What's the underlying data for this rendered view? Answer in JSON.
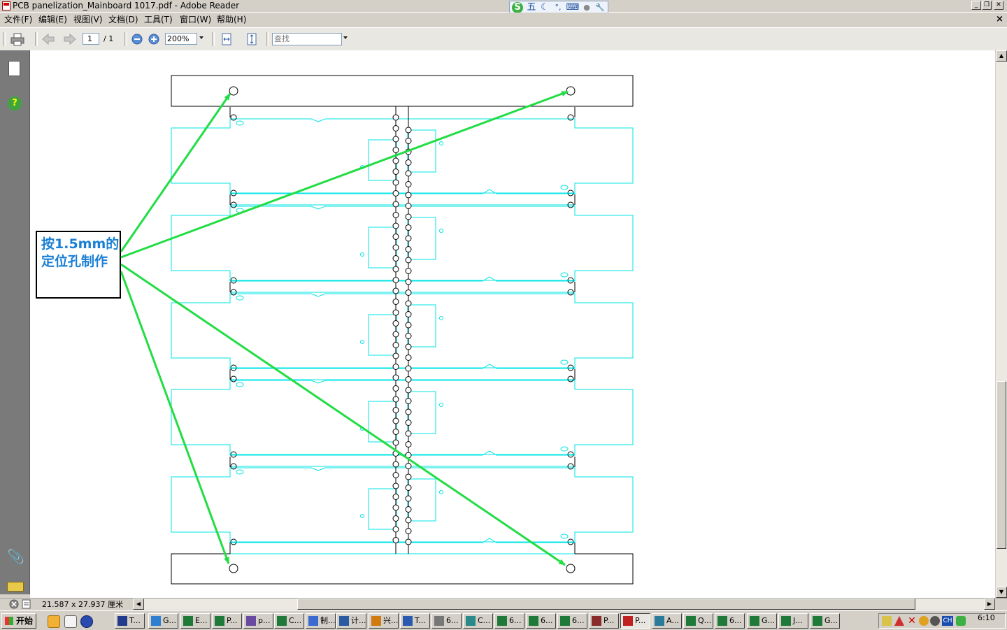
{
  "window": {
    "title": "PCB panelization_Mainboard 1017.pdf - Adobe Reader",
    "min_glyph": "_",
    "restore_glyph": "❐",
    "close_glyph": "✕"
  },
  "ime_bar": {
    "items": [
      "S",
      "五",
      "☾",
      "°,",
      "⌨",
      "●",
      "🔧"
    ]
  },
  "menu": {
    "items": [
      "文件(F)",
      "编辑(E)",
      "视图(V)",
      "文档(D)",
      "工具(T)",
      "窗口(W)",
      "帮助(H)"
    ],
    "doc_close": "×"
  },
  "toolbar": {
    "page_current": "1",
    "page_total": "/ 1",
    "zoom": "200%",
    "find_placeholder": "查找",
    "icons": [
      "print-icon",
      "prev-page-icon",
      "next-page-icon",
      "zoom-out-icon",
      "zoom-in-icon",
      "fit-width-icon",
      "fit-page-icon"
    ]
  },
  "nav": {
    "help_glyph": "?",
    "attach_glyph": "📎"
  },
  "document": {
    "callout_text": "按1.5mm的定位孔制作",
    "colors": {
      "outline": "#000000",
      "pcb_outline": "#00e5e5",
      "arrow": "#22dd44",
      "callout_text": "#1a7fd4"
    }
  },
  "status": {
    "page_size": "21.587 x 27.937 厘米"
  },
  "scroll": {
    "left_arrow": "◀",
    "right_arrow": "▶",
    "up_arrow": "▲",
    "down_arrow": "▼"
  },
  "taskbar": {
    "start_label": "开始",
    "tasks": [
      {
        "label": "T...",
        "color": "#223a8a"
      },
      {
        "label": "G...",
        "color": "#2f7fd0"
      },
      {
        "label": "E...",
        "color": "#1f7a3a"
      },
      {
        "label": "P...",
        "color": "#1f7a3a"
      },
      {
        "label": "p...",
        "color": "#6a4aa0"
      },
      {
        "label": "C...",
        "color": "#1f7a3a"
      },
      {
        "label": "制...",
        "color": "#3a6ad0"
      },
      {
        "label": "计...",
        "color": "#2a5aa0"
      },
      {
        "label": "兴...",
        "color": "#d07a10"
      },
      {
        "label": "T...",
        "color": "#2a5ab0"
      },
      {
        "label": "6...",
        "color": "#777777"
      },
      {
        "label": "C...",
        "color": "#2a8a8a"
      },
      {
        "label": "6...",
        "color": "#1f7a3a"
      },
      {
        "label": "6...",
        "color": "#1f7a3a"
      },
      {
        "label": "6...",
        "color": "#1f7a3a"
      },
      {
        "label": "P...",
        "color": "#8a2a2a"
      },
      {
        "label": "P...",
        "color": "#c02020",
        "active": true
      },
      {
        "label": "A...",
        "color": "#2a7a9a"
      },
      {
        "label": "Q...",
        "color": "#1f7a3a"
      },
      {
        "label": "6...",
        "color": "#1f7a3a"
      },
      {
        "label": "G...",
        "color": "#1f7a3a"
      },
      {
        "label": "J...",
        "color": "#1f7a3a"
      },
      {
        "label": "G...",
        "color": "#1f7a3a"
      }
    ],
    "clock": "6:10",
    "tray_lang": "CH"
  }
}
